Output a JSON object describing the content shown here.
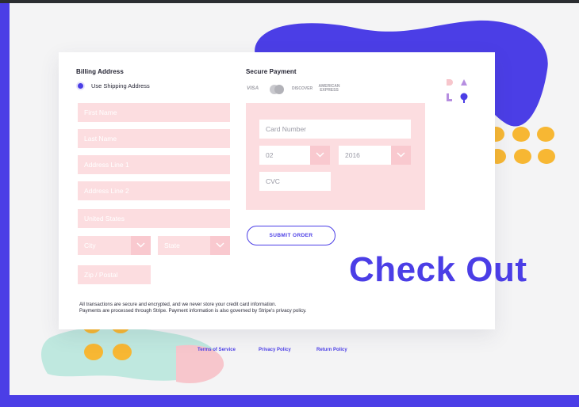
{
  "billing": {
    "title": "Billing Address",
    "use_shipping_label": "Use Shipping Address",
    "fields": {
      "first_name": "First Name",
      "last_name": "Last Name",
      "address1": "Address Line 1",
      "address2": "Address Line 2",
      "country": "United States",
      "city": "City",
      "state": "State",
      "zip": "Zip / Postal"
    }
  },
  "payment": {
    "title": "Secure Payment",
    "card_logos": [
      "VISA",
      "mastercard",
      "DISCOVER",
      "AMERICAN EXPRESS"
    ],
    "card_number_placeholder": "Card Number",
    "month": "02",
    "year": "2016",
    "cvc_placeholder": "CVC",
    "submit_label": "SUBMIT ORDER"
  },
  "footer_note": [
    "All transactions are secure and encrypted, and we never store your credit card information.",
    "Payments are processed through Stripe. Payment information is also governed by Stripe's privacy policy."
  ],
  "headline": "Check Out",
  "links": {
    "terms": "Terms of Service",
    "privacy": "Privacy Policy",
    "returns": "Return Policy"
  },
  "colors": {
    "accent": "#4b3ee6",
    "field_pink": "#fcdde0",
    "dots": "#f7b733",
    "mint": "#bfe8df"
  }
}
